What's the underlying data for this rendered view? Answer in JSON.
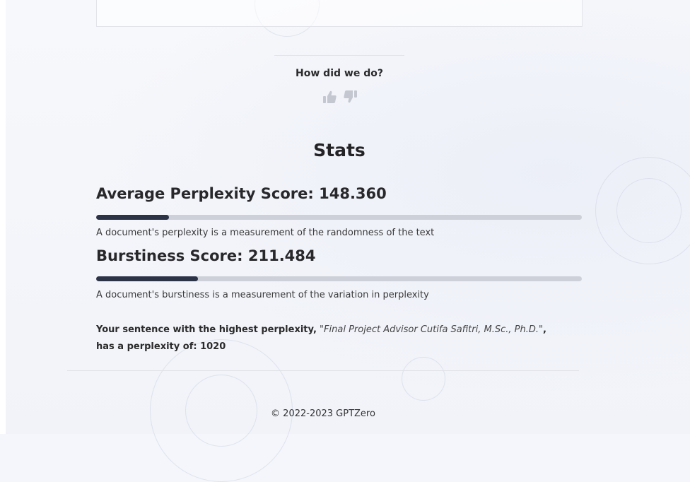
{
  "feedback": {
    "title": "How did we do?",
    "thumbs_up_icon": "thumbs-up-icon",
    "thumbs_down_icon": "thumbs-down-icon"
  },
  "stats": {
    "title": "Stats",
    "perplexity": {
      "title": "Average Perplexity Score: 148.360",
      "progress_fraction": 0.15,
      "description": "A document's perplexity is a measurement of the randomness of the text"
    },
    "burstiness": {
      "title": "Burstiness Score: 211.484",
      "progress_fraction": 0.21,
      "description": "A document's burstiness is a measurement of the variation in perplexity"
    },
    "highest": {
      "lead": "Your sentence with the highest perplexity,",
      "quote": "\"Final Project Advisor Cutifa Safitri, M.Sc., Ph.D.\"",
      "tail": ", has a perplexity of: 1020"
    }
  },
  "footer": {
    "text": "© 2022-2023 GPTZero"
  },
  "colors": {
    "progress_fill": "#2c3346",
    "progress_track": "#cdd0d8",
    "thumb_icon": "#c4c7cf"
  }
}
